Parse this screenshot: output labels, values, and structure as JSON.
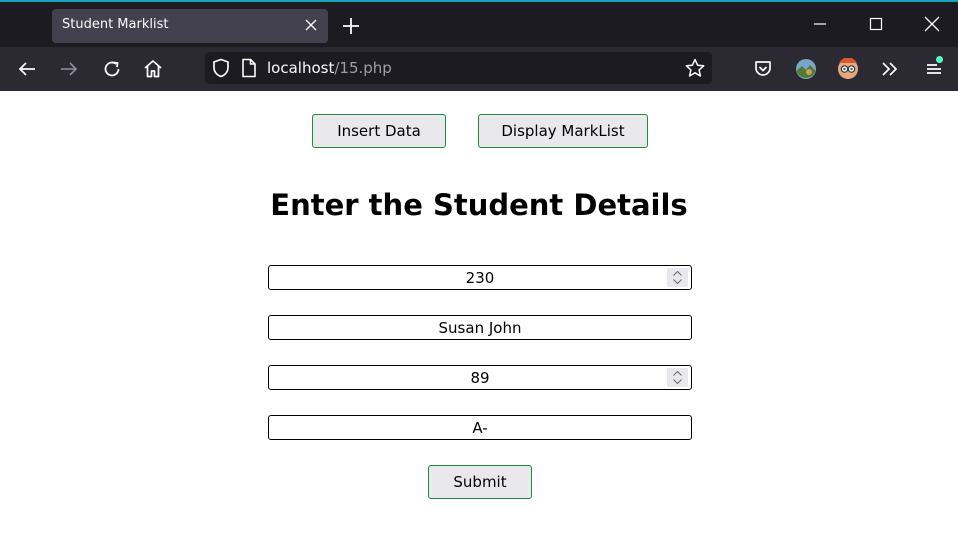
{
  "browser": {
    "tab_title": "Student Marklist",
    "url_host": "localhost",
    "url_path": "/15.php"
  },
  "page": {
    "insert_button": "Insert Data",
    "display_button": "Display MarkList",
    "heading": "Enter the Student Details",
    "fields": [
      {
        "value": "230"
      },
      {
        "value": "Susan John"
      },
      {
        "value": "89"
      },
      {
        "value": "A-"
      }
    ],
    "submit_button": "Submit"
  }
}
